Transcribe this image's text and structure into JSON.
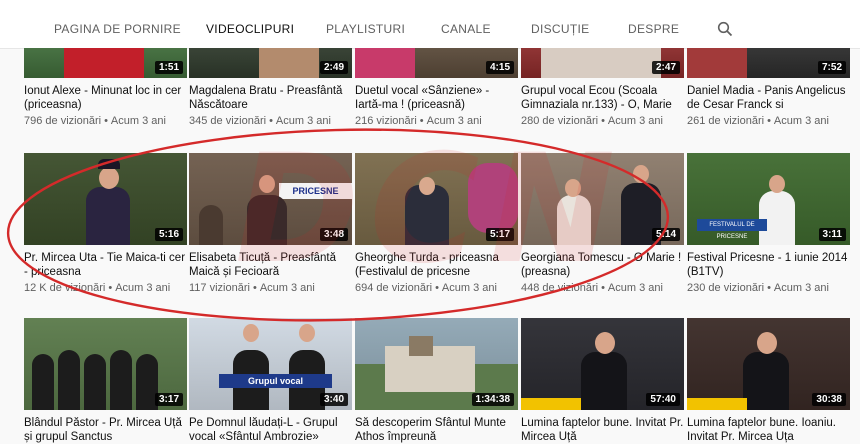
{
  "nav": {
    "tabs": [
      {
        "label": "PAGINA DE PORNIRE"
      },
      {
        "label": "VIDEOCLIPURI"
      },
      {
        "label": "PLAYLISTURI"
      },
      {
        "label": "CANALE"
      },
      {
        "label": "DISCUȚIE"
      },
      {
        "label": "DESPRE"
      }
    ],
    "active_tab": "VIDEOCLIPURI",
    "search_icon": "search-icon"
  },
  "watermark": "DCN",
  "rows": [
    {
      "videos": [
        {
          "title": "Ionut Alexe - Minunat loc in cer (priceasna)",
          "views": "796 de vizionări",
          "age": "Acum 3 ani",
          "duration": "1:51"
        },
        {
          "title": "Magdalena Bratu - Preasfântă Născătoare",
          "views": "345 de vizionări",
          "age": "Acum 3 ani",
          "duration": "2:49"
        },
        {
          "title": "Duetul vocal «Sânziene» - Iartă-ma ! (priceasnă)",
          "views": "216 vizionări",
          "age": "Acum 3 ani",
          "duration": "4:15"
        },
        {
          "title": "Grupul vocal Ecou (Scoala Gimnaziala nr.133) - O, Marie",
          "views": "280 de vizionări",
          "age": "Acum 3 ani",
          "duration": "2:47"
        },
        {
          "title": "Daniel Madia - Panis Angelicus de Cesar Franck si",
          "views": "261 de vizionări",
          "age": "Acum 3 ani",
          "duration": "7:52"
        }
      ]
    },
    {
      "videos": [
        {
          "title": "Pr. Mircea Uta - Tie Maica-ti cer - priceasna",
          "views": "12 K de vizionări",
          "age": "Acum 3 ani",
          "duration": "5:16"
        },
        {
          "title": "Elisabeta Ticuță - Preasfântă Maică și Fecioară",
          "views": "117 vizionări",
          "age": "Acum 3 ani",
          "duration": "3:48"
        },
        {
          "title": "Gheorghe Turda - priceasna (Festivalul de pricesne",
          "views": "694 de vizionări",
          "age": "Acum 3 ani",
          "duration": "5:17"
        },
        {
          "title": "Georgiana Tomescu - O Marie ! (preasna)",
          "views": "448 de vizionări",
          "age": "Acum 3 ani",
          "duration": "5:14"
        },
        {
          "title": "Festival Pricesne - 1 iunie 2014 (B1TV)",
          "views": "230 de vizionări",
          "age": "Acum 3 ani",
          "duration": "3:11"
        }
      ]
    },
    {
      "videos": [
        {
          "title": "Blândul Păstor - Pr. Mircea Uță și grupul Sanctus",
          "views": "",
          "age": "",
          "duration": "3:17"
        },
        {
          "title": "Pe Domnul lăudați-L - Grupul vocal «Sfântul Ambrozie»",
          "views": "",
          "age": "",
          "duration": "3:40"
        },
        {
          "title": "Să descoperim Sfântul Munte Athos împreună",
          "views": "",
          "age": "",
          "duration": "1:34:38"
        },
        {
          "title": "Lumina faptelor bune. Invitat Pr. Mircea Uță",
          "views": "",
          "age": "",
          "duration": "57:40"
        },
        {
          "title": "Lumina faptelor bune. Ioaniu. Invitat Pr. Mircea Uța",
          "views": "",
          "age": "",
          "duration": "30:38"
        }
      ]
    }
  ],
  "colors": {
    "highlight_ellipse": "#d42a2a",
    "watermark": "#d21e1e",
    "active_tab": "#0f0f0f",
    "inactive_tab": "#606060"
  }
}
